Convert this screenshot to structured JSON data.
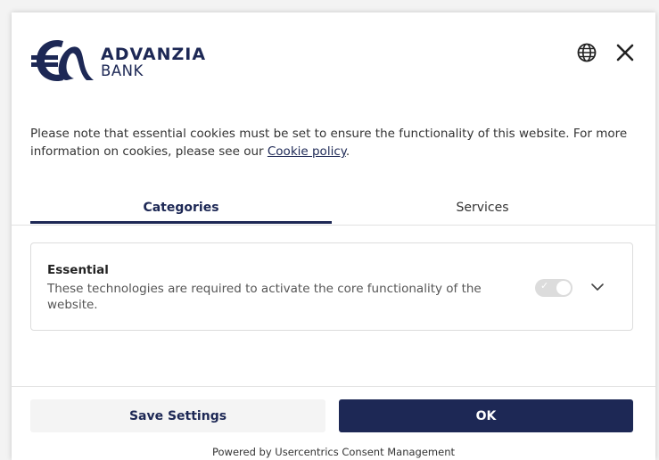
{
  "brand": {
    "line1": "ADVANZIA",
    "line2": "BANK",
    "color": "#1d2855"
  },
  "header": {
    "language_icon": "globe-icon",
    "close_icon": "close-icon"
  },
  "notice": {
    "text": "Please note that essential cookies must be set to ensure the functionality of this website. For more information on cookies, please see our ",
    "link": "Cookie policy",
    "suffix": "."
  },
  "tabs": [
    {
      "label": "Categories",
      "active": true
    },
    {
      "label": "Services",
      "active": false
    }
  ],
  "categories": [
    {
      "title": "Essential",
      "description": "These technologies are required to activate the core functionality of the website.",
      "toggle_enabled": true,
      "toggle_disabled": true
    }
  ],
  "buttons": {
    "save": "Save Settings",
    "ok": "OK"
  },
  "footer": {
    "powered_by": "Powered by Usercentrics Consent Management"
  }
}
